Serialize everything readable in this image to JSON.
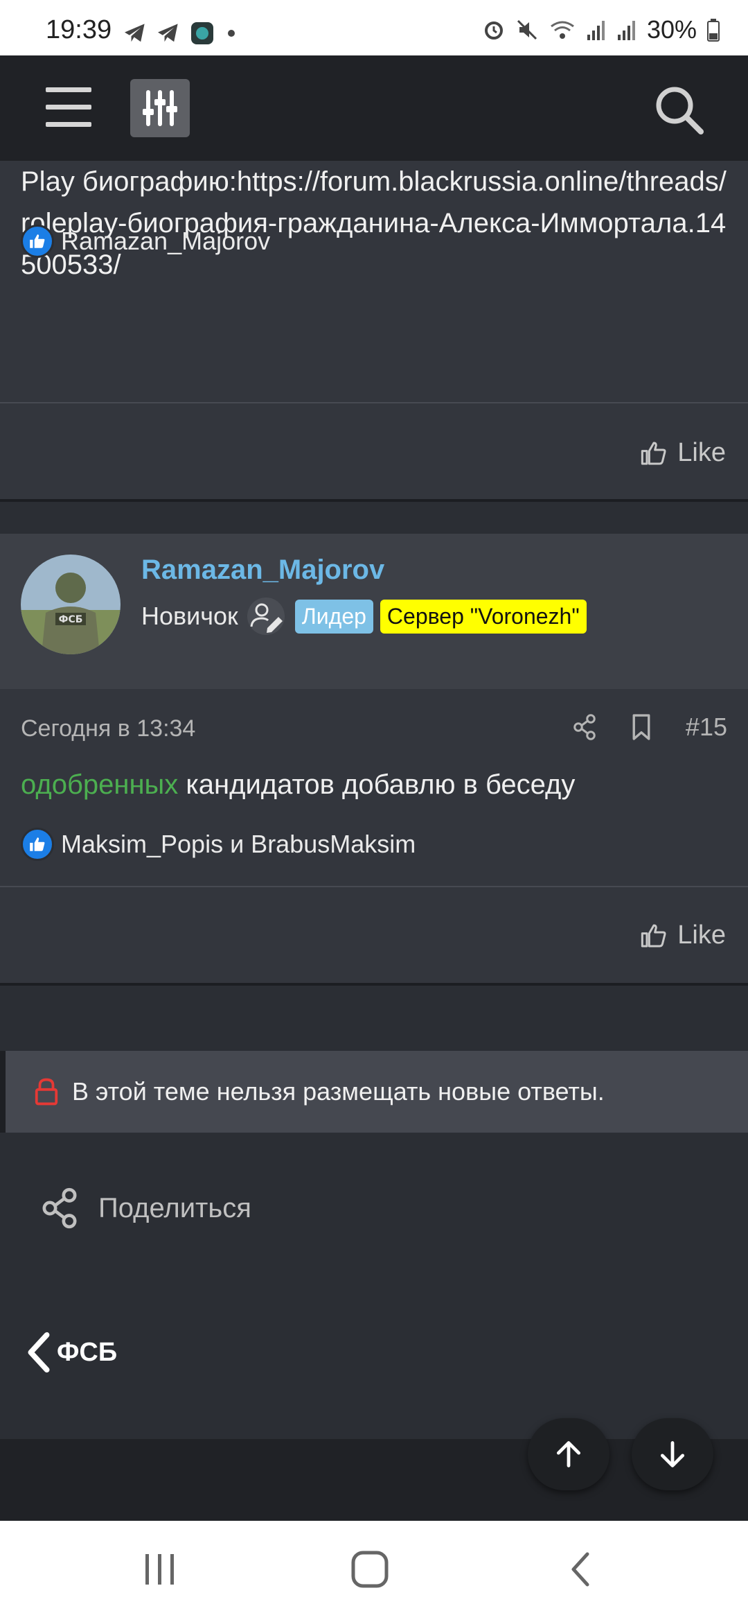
{
  "status_bar": {
    "time": "19:39",
    "battery": "30%",
    "icons": [
      "telegram-icon",
      "telegram-icon",
      "app-icon",
      "dot-icon",
      "alarm-icon",
      "mute-icon",
      "wifi-icon",
      "signal-icon",
      "signal-icon",
      "battery-icon"
    ]
  },
  "navbar": {
    "menu_icon": "hamburger-icon",
    "filter_icon": "sliders-icon",
    "search_icon": "search-icon"
  },
  "post1": {
    "text": "Play биографию:https://forum.blackrussia.online/threads/roleplay-биография-гражданина-Алекса-Иммортала.14500533/",
    "reactions": "Ramazan_Majorov",
    "like_label": "Like"
  },
  "post2": {
    "username": "Ramazan_Majorov",
    "rank": "Новичок",
    "badge_leader": "Лидер",
    "badge_server": "Сервер \"Voronezh\"",
    "date": "Сегодня в 13:34",
    "post_number": "#15",
    "text_green": "одобренных",
    "text_rest": " кандидатов добавлю в беседу",
    "reactions": "Maksim_Popis и BrabusMaksim",
    "like_label": "Like"
  },
  "closed_notice": "В этой теме нельзя размещать новые ответы.",
  "share_label": "Поделиться",
  "back_label": "ФСБ",
  "colors": {
    "accent_username": "#6cb8e6",
    "green_text": "#4caf50",
    "badge_leader": "#7ec1e6",
    "badge_server": "#ffff00",
    "lock": "#e53935"
  }
}
